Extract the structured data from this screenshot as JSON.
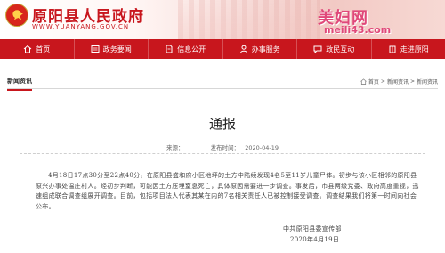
{
  "header": {
    "site_title": "原阳县人民政府",
    "site_url": "WWW.YUANYANG.GOV.CN",
    "watermark_text": "美妇网",
    "watermark_url": "meili43.com"
  },
  "nav": {
    "items": [
      {
        "label": "首页",
        "icon": "home-icon"
      },
      {
        "label": "政务要闻",
        "icon": "newspaper-icon"
      },
      {
        "label": "信息公开",
        "icon": "document-icon"
      },
      {
        "label": "办事服务",
        "icon": "person-icon"
      },
      {
        "label": "政民互动",
        "icon": "chat-icon"
      },
      {
        "label": "走进原阳",
        "icon": "building-icon"
      }
    ]
  },
  "section": {
    "tab_label": "新闻资讯",
    "breadcrumb": [
      "首页",
      "新闻资讯",
      "新闻资讯"
    ]
  },
  "article": {
    "title": "通报",
    "source_label": "来源：",
    "source_value": "",
    "time_label": "发布时间：",
    "time_value": "2020-04-19",
    "body": "4月18日17点30分至22点40分，在原阳县盛和府小区地坪的土方中陆续发现4名5至11岁儿童尸体。初步与该小区相邻的原阳县原兴办事处温庄村人。经初步判断，可能因土方压埋窒息死亡，具体原因需要进一步调查。事发后，市县两级党委、政府高度重视，迅速组成联合调查组展开调查。目前，包括项目法人代表其某在内的7名相关责任人已被控制接受调查。调查结果我们将第一时间向社会公布。",
    "sign_org": "中共原阳县委宣传部",
    "sign_date": "2020年4月19日"
  },
  "colors": {
    "brand_red": "#c8161d",
    "watermark_pink": "#e0487a"
  }
}
